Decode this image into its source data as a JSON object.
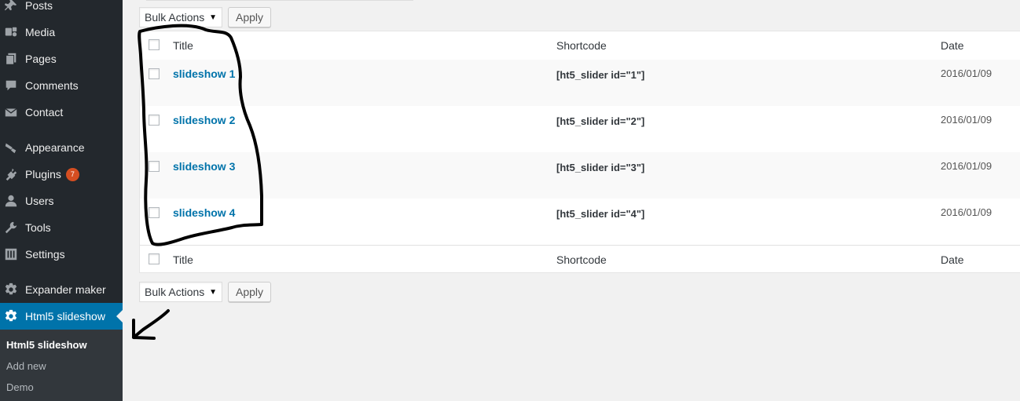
{
  "sidebar": {
    "items": [
      {
        "label": "Posts",
        "icon": "pushpin-icon"
      },
      {
        "label": "Media",
        "icon": "media-icon"
      },
      {
        "label": "Pages",
        "icon": "pages-icon"
      },
      {
        "label": "Comments",
        "icon": "comment-bubble-icon"
      },
      {
        "label": "Contact",
        "icon": "envelope-icon"
      },
      {
        "label": "Appearance",
        "icon": "paintbrush-icon"
      },
      {
        "label": "Plugins",
        "icon": "plug-icon",
        "badge": "7"
      },
      {
        "label": "Users",
        "icon": "user-icon"
      },
      {
        "label": "Tools",
        "icon": "wrench-icon"
      },
      {
        "label": "Settings",
        "icon": "settings-sliders-icon"
      },
      {
        "label": "Expander maker",
        "icon": "gear-icon"
      },
      {
        "label": "Html5 slideshow",
        "icon": "gear-icon",
        "current": true
      }
    ],
    "submenu": [
      {
        "label": "Html5 slideshow",
        "current": true
      },
      {
        "label": "Add new"
      },
      {
        "label": "Demo"
      }
    ]
  },
  "bulk_top": {
    "select_value": "Bulk Actions",
    "apply_label": "Apply"
  },
  "bulk_bottom": {
    "select_value": "Bulk Actions",
    "apply_label": "Apply"
  },
  "table": {
    "columns": [
      "Title",
      "Shortcode",
      "Date"
    ],
    "rows": [
      {
        "title": "slideshow 1",
        "shortcode": "[ht5_slider id=\"1\"]",
        "date": "2016/01/09"
      },
      {
        "title": "slideshow 2",
        "shortcode": "[ht5_slider id=\"2\"]",
        "date": "2016/01/09"
      },
      {
        "title": "slideshow 3",
        "shortcode": "[ht5_slider id=\"3\"]",
        "date": "2016/01/09"
      },
      {
        "title": "slideshow 4",
        "shortcode": "[ht5_slider id=\"4\"]",
        "date": "2016/01/09"
      }
    ]
  },
  "colors": {
    "sidebar_bg": "#23282d",
    "submenu_bg": "#32373c",
    "accent": "#0073aa",
    "badge": "#d54e21",
    "annotation": "#000000"
  }
}
